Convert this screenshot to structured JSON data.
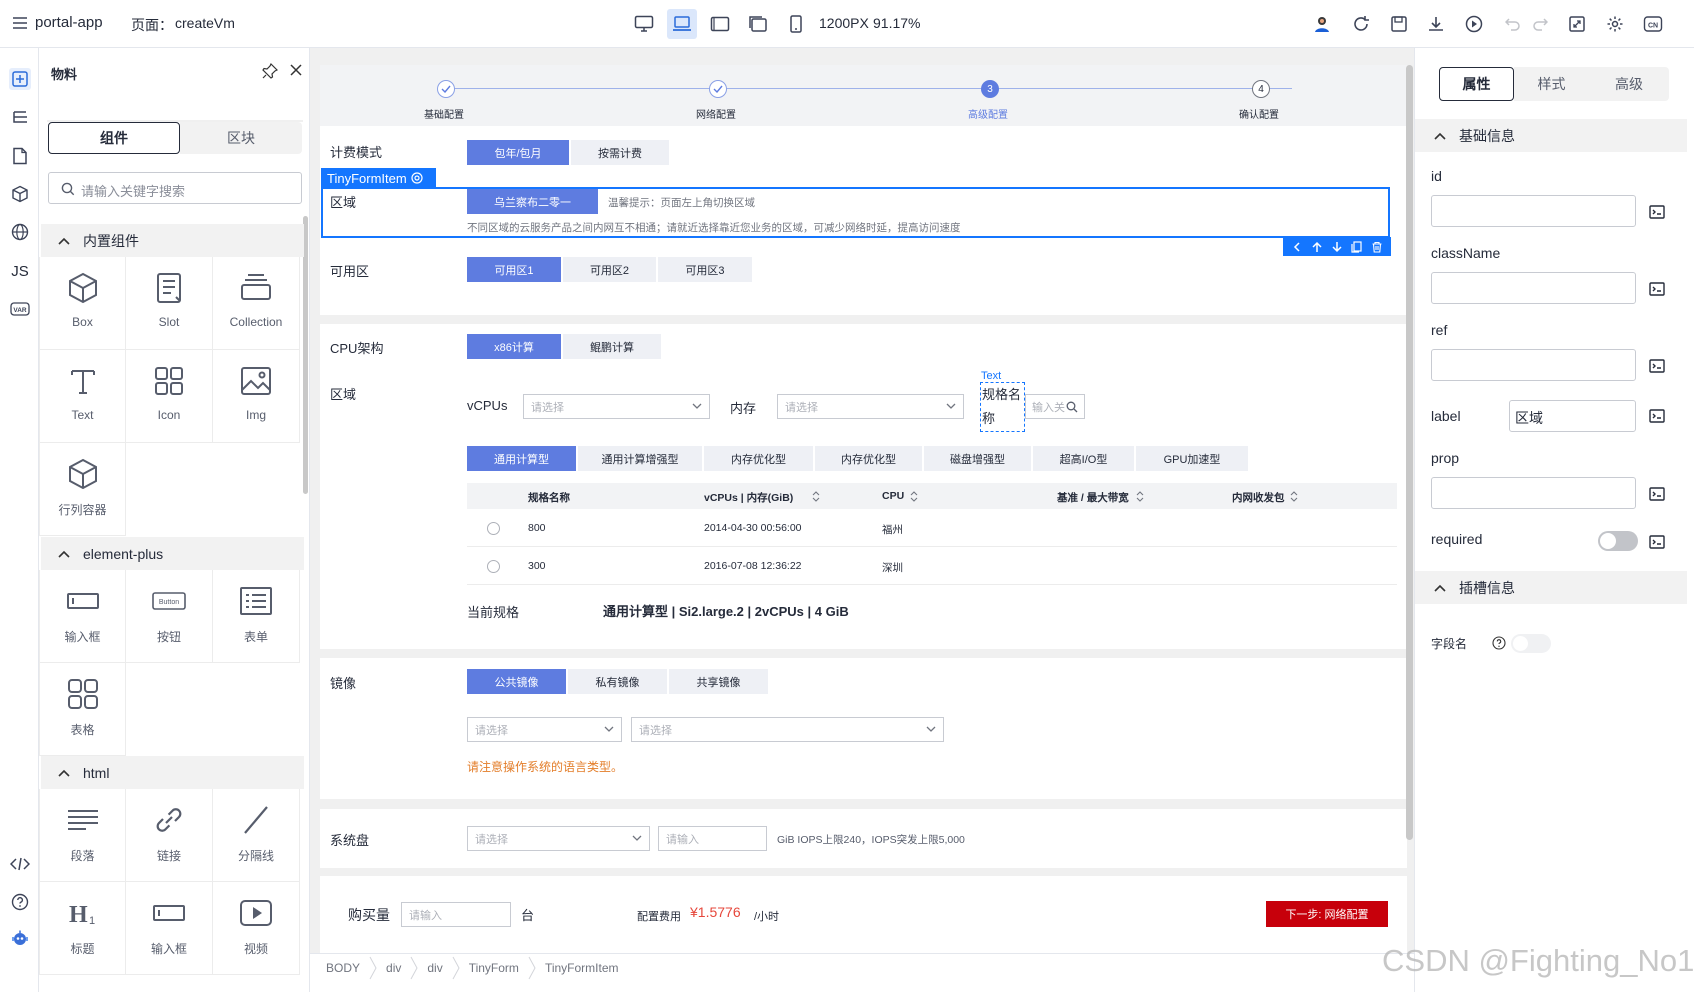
{
  "topbar": {
    "app_name": "portal-app",
    "page_prefix": "页面：",
    "page_name": "createVm",
    "viewport": "1200PX",
    "zoom": "91.17%"
  },
  "materials": {
    "title": "物料",
    "tabs": [
      "组件",
      "区块"
    ],
    "active_tab": "组件",
    "search_placeholder": "请输入关键字搜索",
    "sections": [
      {
        "title": "内置组件",
        "items": [
          "Box",
          "Slot",
          "Collection",
          "Text",
          "Icon",
          "Img",
          "行列容器"
        ]
      },
      {
        "title": "element-plus",
        "items": [
          "输入框",
          "按钮",
          "表单",
          "表格"
        ]
      },
      {
        "title": "html",
        "items": [
          "段落",
          "链接",
          "分隔线",
          "标题",
          "输入框",
          "视频"
        ]
      }
    ],
    "button_icon_text": "Button"
  },
  "canvas": {
    "steps": [
      {
        "label": "基础配置",
        "state": "done"
      },
      {
        "label": "网络配置",
        "state": "done"
      },
      {
        "label": "高级配置",
        "state": "current",
        "number": "3"
      },
      {
        "label": "确认配置",
        "state": "todo",
        "number": "4"
      }
    ],
    "billing": {
      "label": "计费模式",
      "options": [
        "包年/包月",
        "按需计费"
      ],
      "active": "包年/包月"
    },
    "selected_tag": "TinyFormItem",
    "region": {
      "label": "区域",
      "value": "乌兰察布二零一",
      "tip": "温馨提示：页面左上角切换区域",
      "desc": "不同区域的云服务产品之间内网互不相通；请就近选择靠近您业务的区域，可减少网络时延，提高访问速度"
    },
    "az": {
      "label": "可用区",
      "options": [
        "可用区1",
        "可用区2",
        "可用区3"
      ],
      "active": "可用区1"
    },
    "cpu_arch": {
      "label": "CPU架构",
      "options": [
        "x86计算",
        "鲲鹏计算"
      ],
      "active": "x86计算"
    },
    "spec_region_label": "区域",
    "vcpus_label": "vCPUs",
    "vcpus_placeholder": "请选择",
    "memory_label": "内存",
    "memory_placeholder": "请选择",
    "text_tag": "Text",
    "spec_name_label": "规格名称",
    "spec_search_placeholder": "输入关",
    "spec_types": [
      "通用计算型",
      "通用计算增强型",
      "内存优化型",
      "内存优化型",
      "磁盘增强型",
      "超高I/O型",
      "GPU加速型"
    ],
    "spec_active": "通用计算型",
    "table": {
      "columns": [
        "规格名称",
        "vCPUs | 内存(GiB)",
        "CPU",
        "基准 / 最大带宽",
        "内网收发包"
      ],
      "rows": [
        [
          "800",
          "2014-04-30 00:56:00",
          "福州",
          "",
          ""
        ],
        [
          "300",
          "2016-07-08 12:36:22",
          "深圳",
          "",
          ""
        ]
      ]
    },
    "current_spec_label": "当前规格",
    "current_spec_value": "通用计算型 | Si2.large.2 | 2vCPUs | 4 GiB",
    "image": {
      "label": "镜像",
      "options": [
        "公共镜像",
        "私有镜像",
        "共享镜像"
      ],
      "active": "公共镜像",
      "select1_placeholder": "请选择",
      "select2_placeholder": "请选择",
      "warning": "请注意操作系统的语言类型。"
    },
    "disk": {
      "label": "系统盘",
      "select_placeholder": "请选择",
      "input_placeholder": "请输入",
      "info": "GiB IOPS上限240，IOPS突发上限5,000"
    },
    "footer": {
      "qty_label": "购买量",
      "qty_placeholder": "请输入",
      "unit": "台",
      "fee_label": "配置费用",
      "fee_value": "¥1.5776",
      "fee_unit": "/小时",
      "next_button": "下一步: 网络配置"
    },
    "breadcrumb": [
      "BODY",
      "div",
      "div",
      "TinyForm",
      "TinyFormItem"
    ]
  },
  "props": {
    "tabs": [
      "属性",
      "样式",
      "高级"
    ],
    "active_tab": "属性",
    "basic_section": "基础信息",
    "fields": [
      {
        "label": "id",
        "value": ""
      },
      {
        "label": "className",
        "value": ""
      },
      {
        "label": "ref",
        "value": ""
      },
      {
        "label": "label",
        "value": "区域"
      },
      {
        "label": "prop",
        "value": ""
      },
      {
        "label": "required",
        "value": "off"
      }
    ],
    "slot_section": "插槽信息",
    "slot_field_label": "字段名"
  },
  "watermark": "CSDN @Fighting_No1",
  "colors": {
    "primary": "#5e7ce0",
    "step_current": "#5e7ce0",
    "selection_border": "#1476ff",
    "next_button": "#c7000b",
    "fee": "#e6473b",
    "warning": "#e37d29"
  }
}
